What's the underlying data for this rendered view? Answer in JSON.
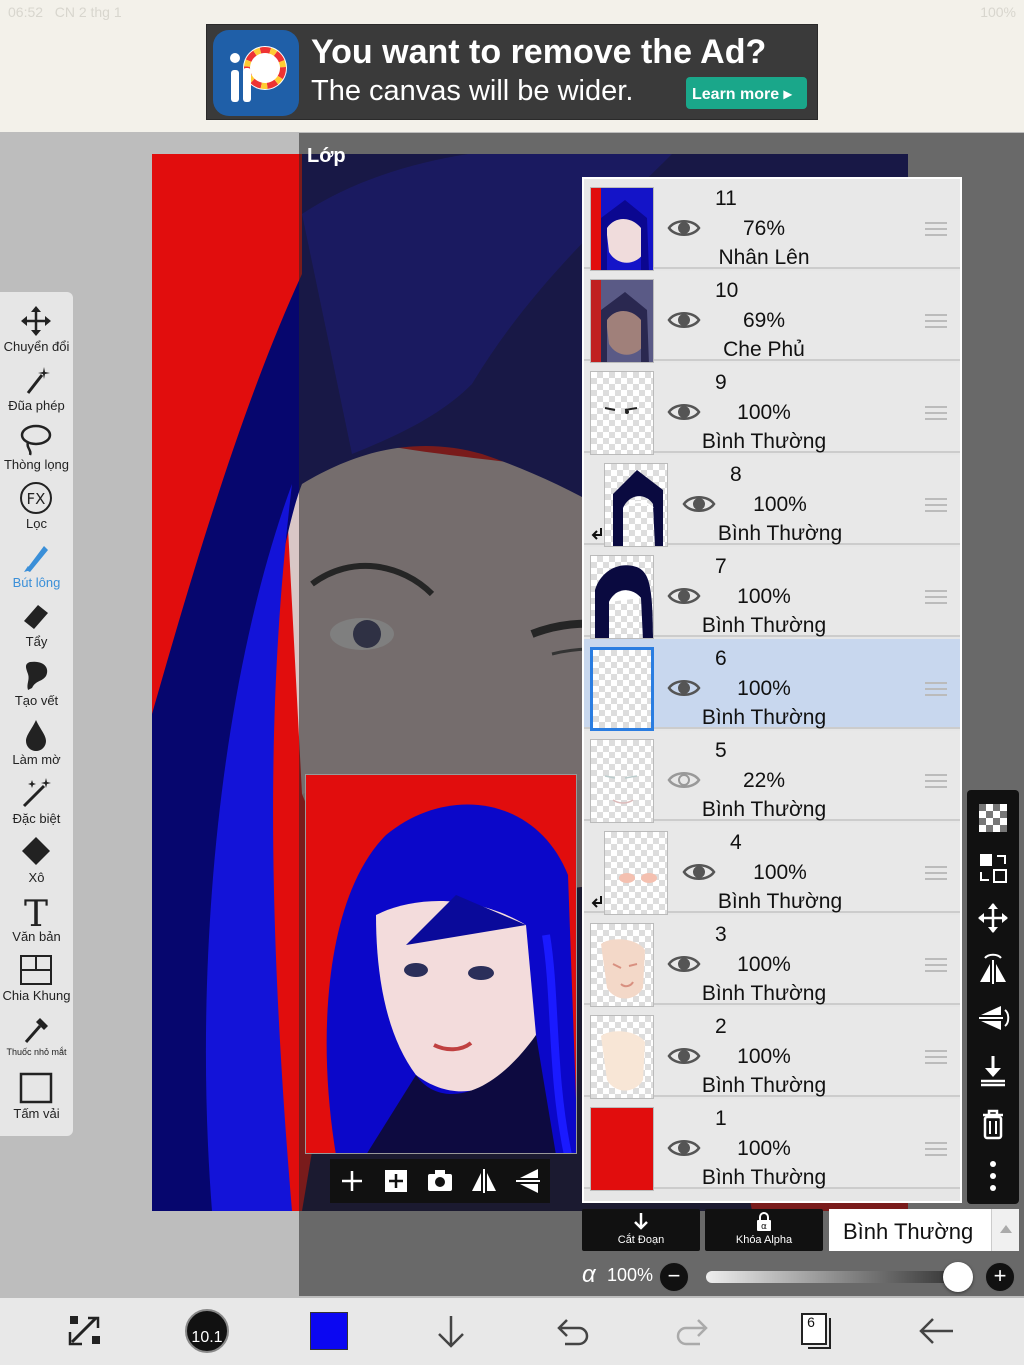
{
  "status": {
    "time": "06:52",
    "date": "CN 2 thg 1",
    "battery": "100%"
  },
  "ad": {
    "title": "You want to remove the Ad?",
    "subtitle": "The canvas will be wider.",
    "button_label": "Learn more ▸"
  },
  "toolbar": {
    "tools": [
      {
        "label": "Chuyển đổi",
        "icon": "move-icon"
      },
      {
        "label": "Đũa phép",
        "icon": "magic-wand-icon"
      },
      {
        "label": "Thòng lọng",
        "icon": "lasso-icon"
      },
      {
        "label": "Lọc",
        "icon": "fx-filter-icon"
      },
      {
        "label": "Bút lông",
        "icon": "brush-icon",
        "active": true
      },
      {
        "label": "Tẩy",
        "icon": "eraser-icon"
      },
      {
        "label": "Tạo vết",
        "icon": "smudge-icon"
      },
      {
        "label": "Làm mờ",
        "icon": "blur-drop-icon"
      },
      {
        "label": "Đặc biệt",
        "icon": "special-brush-icon"
      },
      {
        "label": "Xô",
        "icon": "bucket-icon"
      },
      {
        "label": "Văn bản",
        "icon": "text-icon"
      },
      {
        "label": "Chia Khung",
        "icon": "frame-divider-icon"
      },
      {
        "label": "Thuốc nhỏ mắt",
        "icon": "eyedropper-icon"
      },
      {
        "label": "Tấm vải",
        "icon": "canvas-icon"
      }
    ]
  },
  "layer_panel": {
    "title": "Lớp",
    "layers": [
      {
        "number": "11",
        "opacity": "76%",
        "mode": "Nhân Lên",
        "thumb": "face-blue-hair",
        "clipped": false
      },
      {
        "number": "10",
        "opacity": "69%",
        "mode": "Che Phủ",
        "thumb": "face-dark",
        "clipped": false
      },
      {
        "number": "9",
        "opacity": "100%",
        "mode": "Bình Thường",
        "thumb": "eyes-sketch",
        "clipped": false
      },
      {
        "number": "8",
        "opacity": "100%",
        "mode": "Bình Thường",
        "thumb": "hair-lines",
        "clipped": true
      },
      {
        "number": "7",
        "opacity": "100%",
        "mode": "Bình Thường",
        "thumb": "hair-solid",
        "clipped": false
      },
      {
        "number": "6",
        "opacity": "100%",
        "mode": "Bình Thường",
        "thumb": "blank",
        "clipped": false,
        "selected": true
      },
      {
        "number": "5",
        "opacity": "22%",
        "mode": "Bình Thường",
        "thumb": "faint-sketch",
        "clipped": false,
        "hidden": true
      },
      {
        "number": "4",
        "opacity": "100%",
        "mode": "Bình Thường",
        "thumb": "blush",
        "clipped": true
      },
      {
        "number": "3",
        "opacity": "100%",
        "mode": "Bình Thường",
        "thumb": "skin-shade",
        "clipped": false
      },
      {
        "number": "2",
        "opacity": "100%",
        "mode": "Bình Thường",
        "thumb": "skin-base",
        "clipped": false
      },
      {
        "number": "1",
        "opacity": "100%",
        "mode": "Bình Thường",
        "thumb": "red-fill",
        "clipped": false
      }
    ],
    "clipping_label": "Cắt Đoạn",
    "alpha_lock_label": "Khóa Alpha",
    "blend_mode": "Bình Thường",
    "alpha_symbol": "α",
    "opacity_label": "100%",
    "opacity_value": 1.0
  },
  "bottombar": {
    "brush_size": "10.1",
    "color": "#0b07f2",
    "layer_count": "6"
  },
  "colors": {
    "canvas_red": "#e10d0d",
    "hair_blue": "#0b07f2",
    "accent": "#2a7de1"
  }
}
